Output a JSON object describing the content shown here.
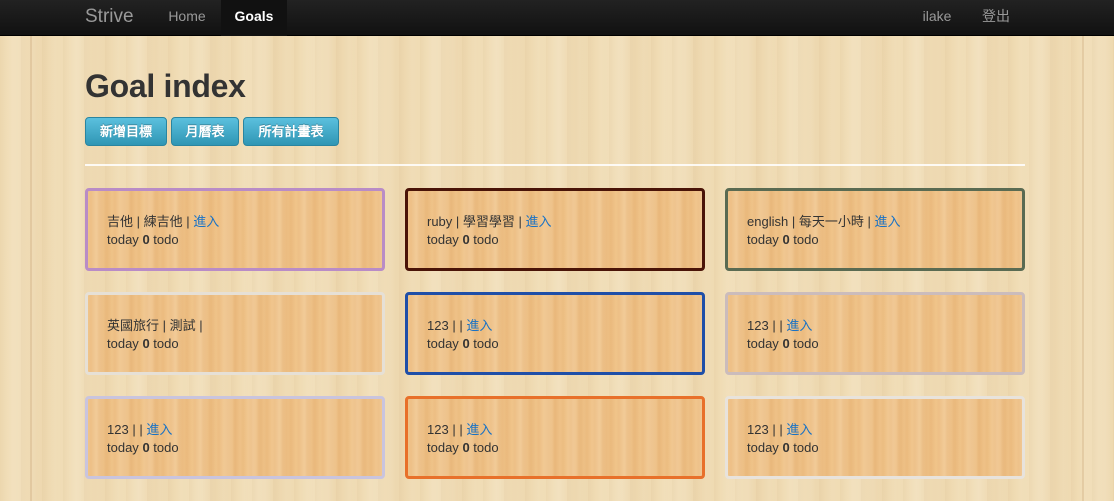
{
  "navbar": {
    "brand": "Strive",
    "items": [
      {
        "label": "Home"
      },
      {
        "label": "Goals"
      }
    ],
    "right_items": [
      {
        "label": "ilake"
      },
      {
        "label": "登出"
      }
    ]
  },
  "main": {
    "title": "Goal index",
    "buttons": [
      {
        "label": "新增目標"
      },
      {
        "label": "月曆表"
      },
      {
        "label": "所有計畫表"
      }
    ]
  },
  "colors": {
    "card_borders": [
      "#b98cc6",
      "#4a1408",
      "#5a6b52",
      "#e6e0d6",
      "#1f4fa8",
      "#cbbcbc",
      "#c9c4de",
      "#e8702a",
      "#e8e3dc"
    ],
    "button": "#2f96b4",
    "link": "#1a72c4"
  },
  "goals": [
    {
      "title": "吉他",
      "desc": "練吉他",
      "link": "進入",
      "count_prefix": "today",
      "count": "0",
      "count_suffix": "todo"
    },
    {
      "title": "ruby",
      "desc": "學習學習",
      "link": "進入",
      "count_prefix": "today",
      "count": "0",
      "count_suffix": "todo"
    },
    {
      "title": "english",
      "desc": "每天一小時",
      "link": "進入",
      "count_prefix": "today",
      "count": "0",
      "count_suffix": "todo"
    },
    {
      "title": "英國旅行",
      "desc": "測試",
      "link": "",
      "count_prefix": "today",
      "count": "0",
      "count_suffix": "todo"
    },
    {
      "title": "123",
      "desc": "",
      "link": "進入",
      "count_prefix": "today",
      "count": "0",
      "count_suffix": "todo"
    },
    {
      "title": "123",
      "desc": "",
      "link": "進入",
      "count_prefix": "today",
      "count": "0",
      "count_suffix": "todo"
    },
    {
      "title": "123",
      "desc": "",
      "link": "進入",
      "count_prefix": "today",
      "count": "0",
      "count_suffix": "todo"
    },
    {
      "title": "123",
      "desc": "",
      "link": "進入",
      "count_prefix": "today",
      "count": "0",
      "count_suffix": "todo"
    },
    {
      "title": "123",
      "desc": "",
      "link": "進入",
      "count_prefix": "today",
      "count": "0",
      "count_suffix": "todo"
    }
  ]
}
